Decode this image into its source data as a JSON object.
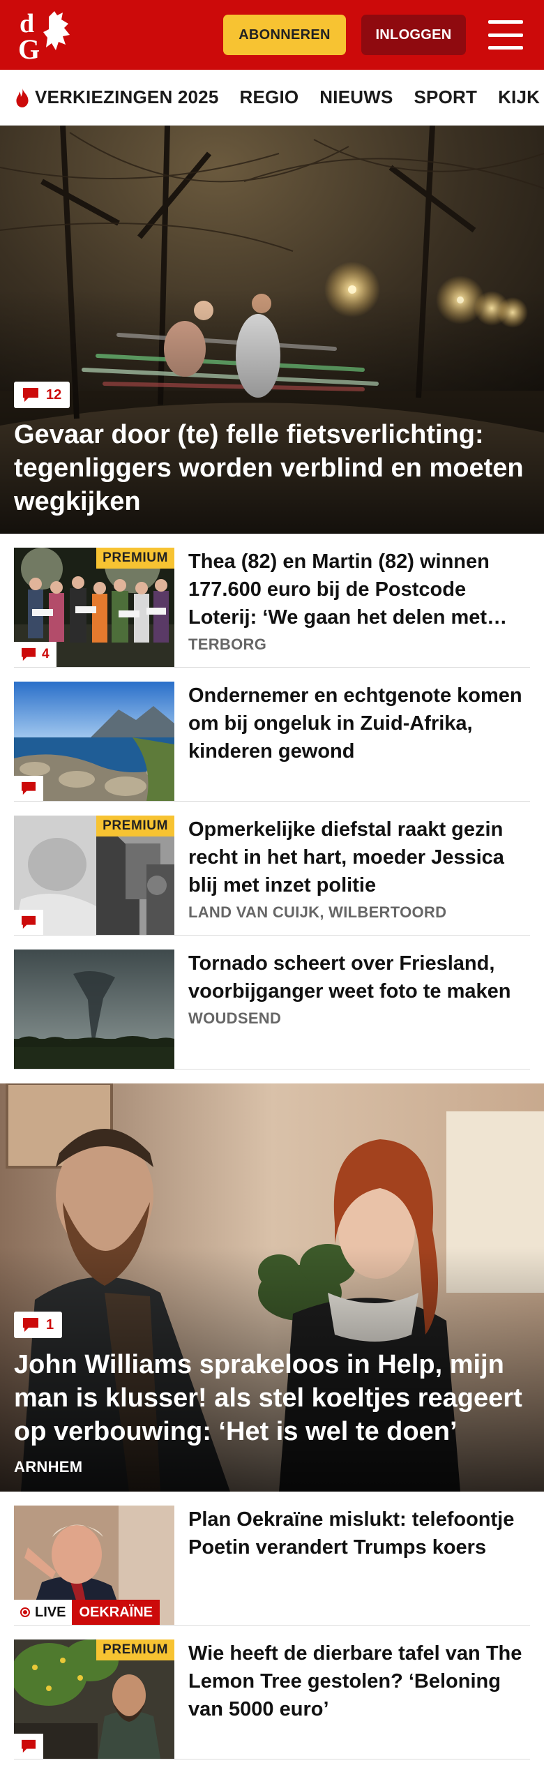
{
  "header": {
    "logo_letters": "dG",
    "subscribe_label": "ABONNEREN",
    "login_label": "INLOGGEN"
  },
  "nav": {
    "items": [
      {
        "label": "VERKIEZINGEN 2025",
        "icon": "flame-icon"
      },
      {
        "label": "REGIO"
      },
      {
        "label": "NIEUWS"
      },
      {
        "label": "SPORT"
      },
      {
        "label": "KIJK"
      }
    ]
  },
  "hero1": {
    "comments": "12",
    "title": "Gevaar door (te) felle fietsverlichting: tegenliggers worden verblind en moeten wegkijken"
  },
  "articles1": [
    {
      "title": "Thea (82) en Martin (82) winnen 177.600 euro bij de Postcode Loterij: ‘We gaan het delen met…",
      "location": "TERBORG",
      "premium": "PREMIUM",
      "comments": "4"
    },
    {
      "title": "Ondernemer en echtgenote komen om bij ongeluk in Zuid-Afrika, kinderen gewond",
      "location": "",
      "premium": "",
      "comments": ""
    },
    {
      "title": "Opmerkelijke diefstal raakt gezin recht in het hart, moeder Jessica blij met inzet politie",
      "location": "LAND VAN CUIJK, WILBERTOORD",
      "premium": "PREMIUM",
      "comments": ""
    },
    {
      "title": "Tornado scheert over Friesland, voorbijganger weet foto te maken",
      "location": "WOUDSEND",
      "premium": "",
      "comments": ""
    }
  ],
  "hero2": {
    "comments": "1",
    "title": "John Williams sprakeloos in Help, mijn man is klusser! als stel koeltjes reageert op verbouwing: ‘Het is wel te doen’",
    "location": "ARNHEM"
  },
  "articles2": [
    {
      "title": "Plan Oekraïne mislukt: telefoon­tje Poetin verandert Trumps koers",
      "live_label": "LIVE",
      "tag": "OEKRAÏNE"
    },
    {
      "title": "Wie heeft de dierbare tafel van The Lemon Tree gestolen? ‘Beloning van 5000 euro’",
      "premium": "PREMIUM"
    }
  ],
  "colors": {
    "brand_red": "#cc0a0a",
    "premium_yellow": "#f7c332",
    "login_dark_red": "#8f0a0f"
  }
}
